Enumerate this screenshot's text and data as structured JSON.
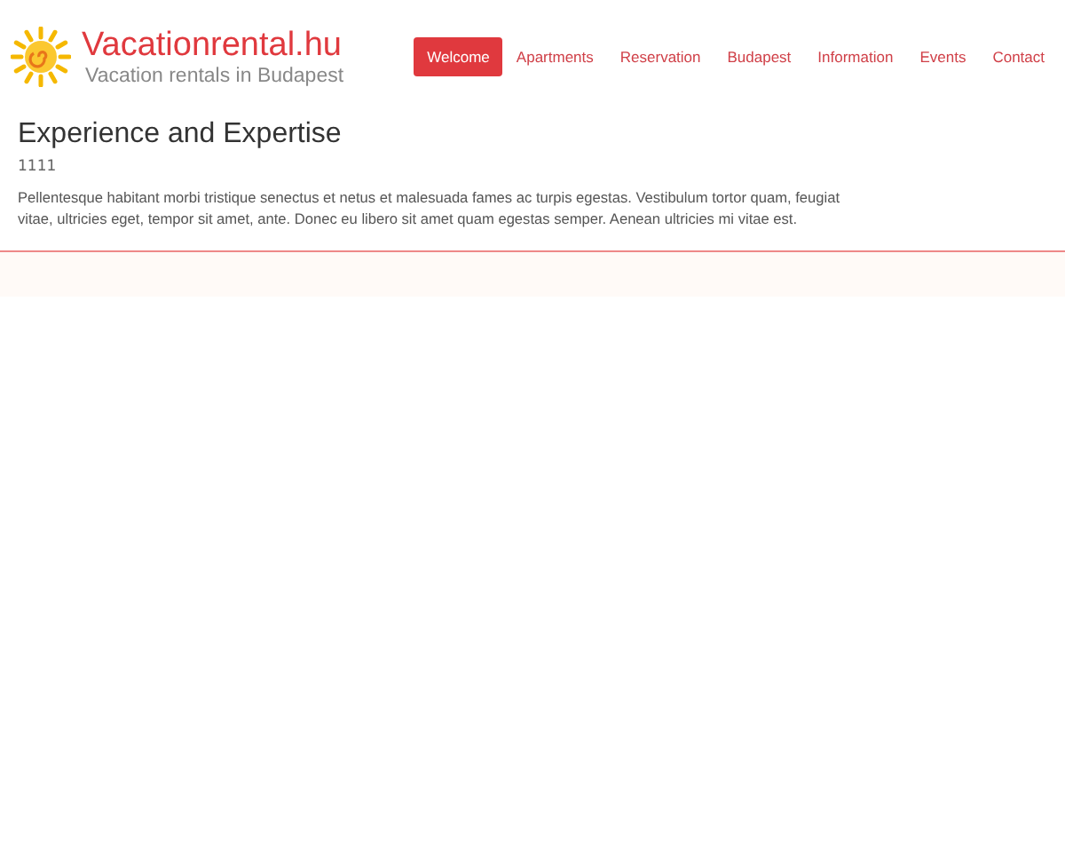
{
  "brand": {
    "name": "Vacationrental.hu",
    "tagline": "Vacation rentals in Budapest"
  },
  "nav": [
    {
      "label": "Welcome",
      "selected": true
    },
    {
      "label": "Apartments",
      "selected": false
    },
    {
      "label": "Reservation",
      "selected": false
    },
    {
      "label": "Budapest",
      "selected": false
    },
    {
      "label": "Information",
      "selected": false
    },
    {
      "label": "Events",
      "selected": false
    },
    {
      "label": "Contact",
      "selected": false
    }
  ],
  "article": {
    "title": "Experience and Expertise",
    "subtitle": "1111",
    "body": "Pellentesque habitant morbi tristique senectus et netus et malesuada fames ac turpis egestas. Vestibulum tortor quam, feugiat vitae, ultricies eget, tempor sit amet, ante. Donec eu libero sit amet quam egestas semper. Aenean ultricies mi vitae est."
  }
}
